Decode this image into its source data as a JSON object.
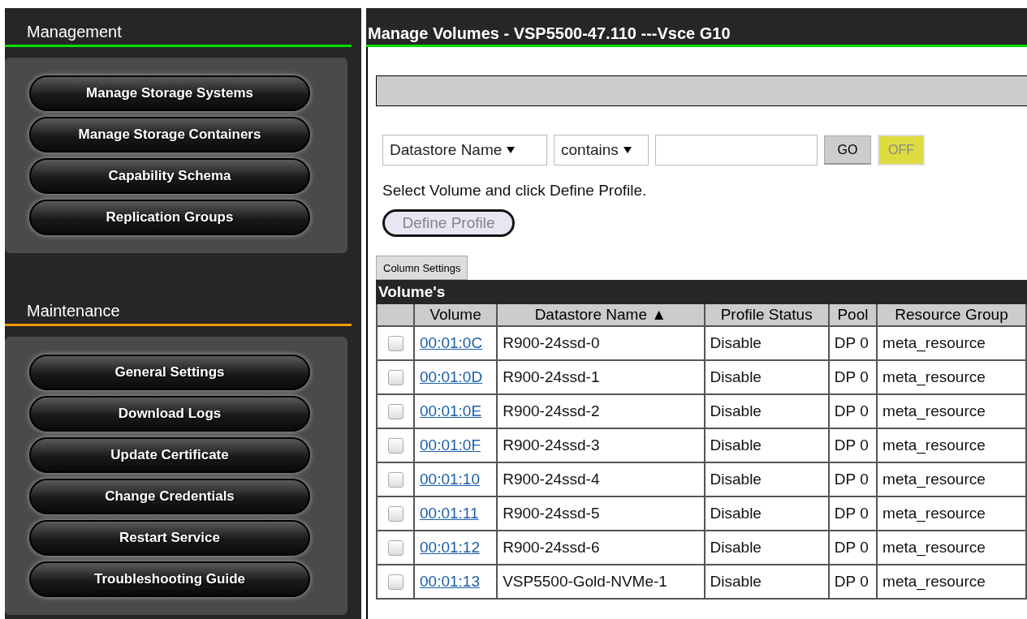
{
  "sidebar": {
    "sections": [
      {
        "title": "Management",
        "color": "#00e000",
        "items": [
          "Manage Storage Systems",
          "Manage Storage Containers",
          "Capability Schema",
          "Replication Groups"
        ]
      },
      {
        "title": "Maintenance",
        "color": "#f29a00",
        "items": [
          "General Settings",
          "Download Logs",
          "Update Certificate",
          "Change Credentials",
          "Restart Service",
          "Troubleshooting Guide"
        ]
      }
    ]
  },
  "main": {
    "title": "Manage Volumes - VSP5500-47.110 ---Vsce G10",
    "filter": {
      "field": "Datastore Name",
      "operator": "contains",
      "go": "GO",
      "toggle": {
        "label": "OFF",
        "on": false
      }
    },
    "instruction": "Select Volume and click Define Profile.",
    "define_profile": {
      "label": "Define Profile",
      "disabled": true
    },
    "column_settings": "Column Settings",
    "table": {
      "title": "Volume's",
      "columns": [
        "Volume",
        "Datastore Name ▲",
        "Profile Status",
        "Pool",
        "Resource Group"
      ],
      "rows": [
        {
          "checked": false,
          "volume": "00:01:0C",
          "datastore": "R900-24ssd-0",
          "status": "Disable",
          "pool": "DP 0",
          "group": "meta_resource"
        },
        {
          "checked": false,
          "volume": "00:01:0D",
          "datastore": "R900-24ssd-1",
          "status": "Disable",
          "pool": "DP 0",
          "group": "meta_resource"
        },
        {
          "checked": false,
          "volume": "00:01:0E",
          "datastore": "R900-24ssd-2",
          "status": "Disable",
          "pool": "DP 0",
          "group": "meta_resource"
        },
        {
          "checked": false,
          "volume": "00:01:0F",
          "datastore": "R900-24ssd-3",
          "status": "Disable",
          "pool": "DP 0",
          "group": "meta_resource"
        },
        {
          "checked": false,
          "volume": "00:01:10",
          "datastore": "R900-24ssd-4",
          "status": "Disable",
          "pool": "DP 0",
          "group": "meta_resource"
        },
        {
          "checked": false,
          "volume": "00:01:11",
          "datastore": "R900-24ssd-5",
          "status": "Disable",
          "pool": "DP 0",
          "group": "meta_resource"
        },
        {
          "checked": false,
          "volume": "00:01:12",
          "datastore": "R900-24ssd-6",
          "status": "Disable",
          "pool": "DP 0",
          "group": "meta_resource"
        },
        {
          "checked": false,
          "volume": "00:01:13",
          "datastore": "VSP5500-Gold-NVMe-1",
          "status": "Disable",
          "pool": "DP 0",
          "group": "meta_resource"
        }
      ]
    }
  }
}
